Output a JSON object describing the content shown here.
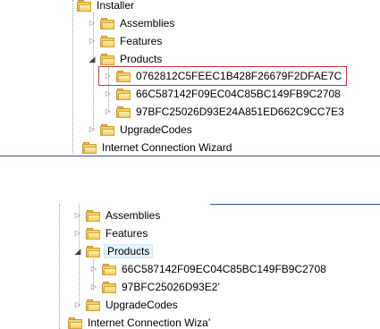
{
  "top_pane": {
    "installer": "Installer",
    "assemblies": "Assemblies",
    "features": "Features",
    "products": "Products",
    "product_1": "0762812C5FEEC1B428F26679F2DFAE7C",
    "product_2": "66C587142F09EC04C85BC149FB9C2708",
    "product_3": "97BFC25026D93E24A851ED662C9CC7E3",
    "upgrade_codes": "UpgradeCodes",
    "internet_wizard": "Internet Connection Wizard"
  },
  "bottom_pane": {
    "assemblies": "Assemblies",
    "features": "Features",
    "products": "Products",
    "product_1": "66C587142F09EC04C85BC149FB9C2708",
    "product_2": "97BFC25026D93E2’",
    "upgrade_codes": "UpgradeCodes",
    "internet_wizard": "Internet Connection Wiza’"
  },
  "icons": {
    "folder": "folder-icon",
    "expand": "triangle-right",
    "collapse": "triangle-down"
  },
  "colors": {
    "highlight_box": "#d0363b",
    "separator": "#3a4aa0",
    "selection": "#e5f3fb"
  }
}
